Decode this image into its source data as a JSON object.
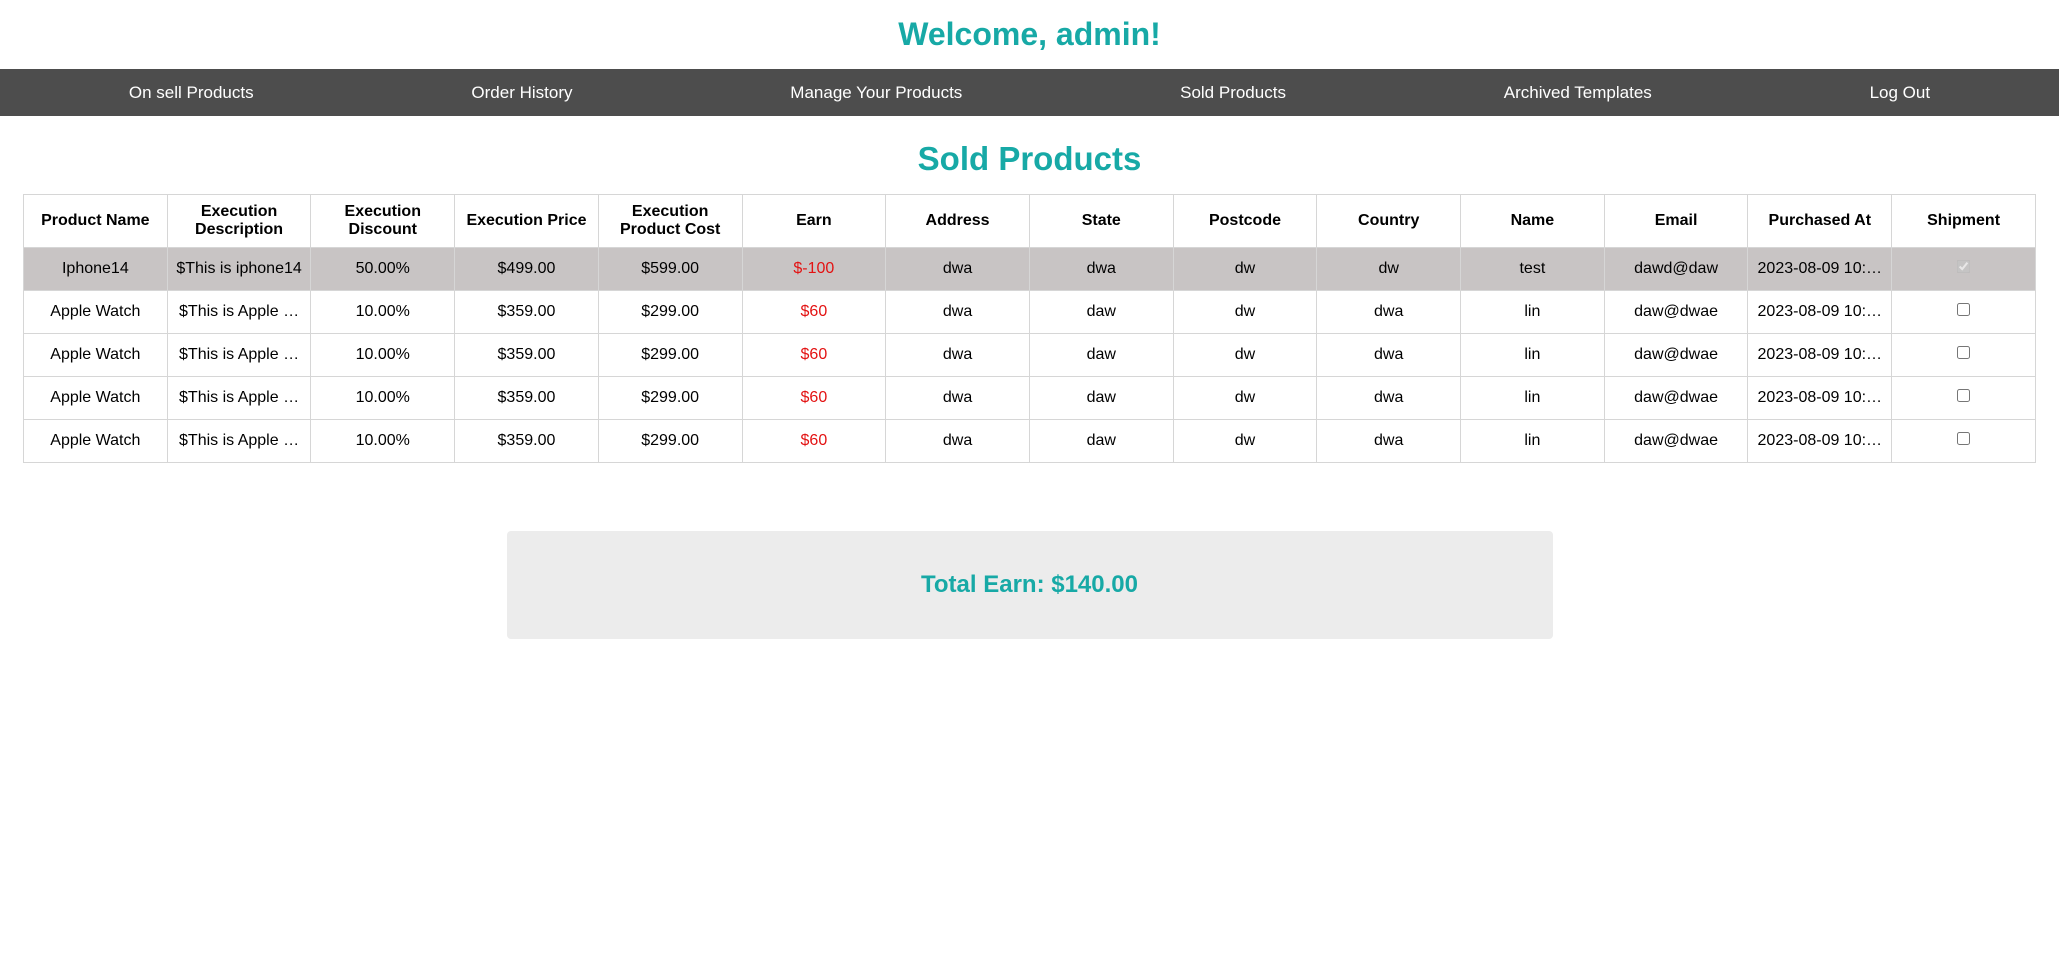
{
  "header": {
    "welcome": "Welcome, admin!"
  },
  "nav": {
    "items": [
      {
        "label": "On sell Products",
        "name": "nav-on-sell-products"
      },
      {
        "label": "Order History",
        "name": "nav-order-history"
      },
      {
        "label": "Manage Your Products",
        "name": "nav-manage-products"
      },
      {
        "label": "Sold Products",
        "name": "nav-sold-products"
      },
      {
        "label": "Archived Templates",
        "name": "nav-archived-templates"
      },
      {
        "label": "Log Out",
        "name": "nav-log-out"
      }
    ]
  },
  "main": {
    "title": "Sold Products",
    "columns": [
      "Product Name",
      "Execution Description",
      "Execution Discount",
      "Execution Price",
      "Execution Product Cost",
      "Earn",
      "Address",
      "State",
      "Postcode",
      "Country",
      "Name",
      "Email",
      "Purchased At",
      "Shipment"
    ],
    "rows": [
      {
        "product_name": "Iphone14",
        "description": "$This is iphone14",
        "discount": "50.00%",
        "price": "$499.00",
        "cost": "$599.00",
        "earn": "$-100",
        "address": "dwa",
        "state": "dwa",
        "postcode": "dw",
        "country": "dw",
        "name": "test",
        "email": "dawd@daw",
        "purchased_at": "2023-08-09 10:…",
        "shipped": true,
        "highlighted": true
      },
      {
        "product_name": "Apple Watch",
        "description": "$This is Apple …",
        "discount": "10.00%",
        "price": "$359.00",
        "cost": "$299.00",
        "earn": "$60",
        "address": "dwa",
        "state": "daw",
        "postcode": "dw",
        "country": "dwa",
        "name": "lin",
        "email": "daw@dwae",
        "purchased_at": "2023-08-09 10:…",
        "shipped": false,
        "highlighted": false
      },
      {
        "product_name": "Apple Watch",
        "description": "$This is Apple …",
        "discount": "10.00%",
        "price": "$359.00",
        "cost": "$299.00",
        "earn": "$60",
        "address": "dwa",
        "state": "daw",
        "postcode": "dw",
        "country": "dwa",
        "name": "lin",
        "email": "daw@dwae",
        "purchased_at": "2023-08-09 10:…",
        "shipped": false,
        "highlighted": false
      },
      {
        "product_name": "Apple Watch",
        "description": "$This is Apple …",
        "discount": "10.00%",
        "price": "$359.00",
        "cost": "$299.00",
        "earn": "$60",
        "address": "dwa",
        "state": "daw",
        "postcode": "dw",
        "country": "dwa",
        "name": "lin",
        "email": "daw@dwae",
        "purchased_at": "2023-08-09 10:…",
        "shipped": false,
        "highlighted": false
      },
      {
        "product_name": "Apple Watch",
        "description": "$This is Apple …",
        "discount": "10.00%",
        "price": "$359.00",
        "cost": "$299.00",
        "earn": "$60",
        "address": "dwa",
        "state": "daw",
        "postcode": "dw",
        "country": "dwa",
        "name": "lin",
        "email": "daw@dwae",
        "purchased_at": "2023-08-09 10:…",
        "shipped": false,
        "highlighted": false
      }
    ]
  },
  "summary": {
    "total_earn": "Total Earn: $140.00"
  },
  "colors": {
    "accent": "#17a9a6",
    "nav_bg": "#4d4d4d",
    "earn_text": "#e31212",
    "highlight_row": "#c8c4c4",
    "summary_bg": "#ececec"
  }
}
